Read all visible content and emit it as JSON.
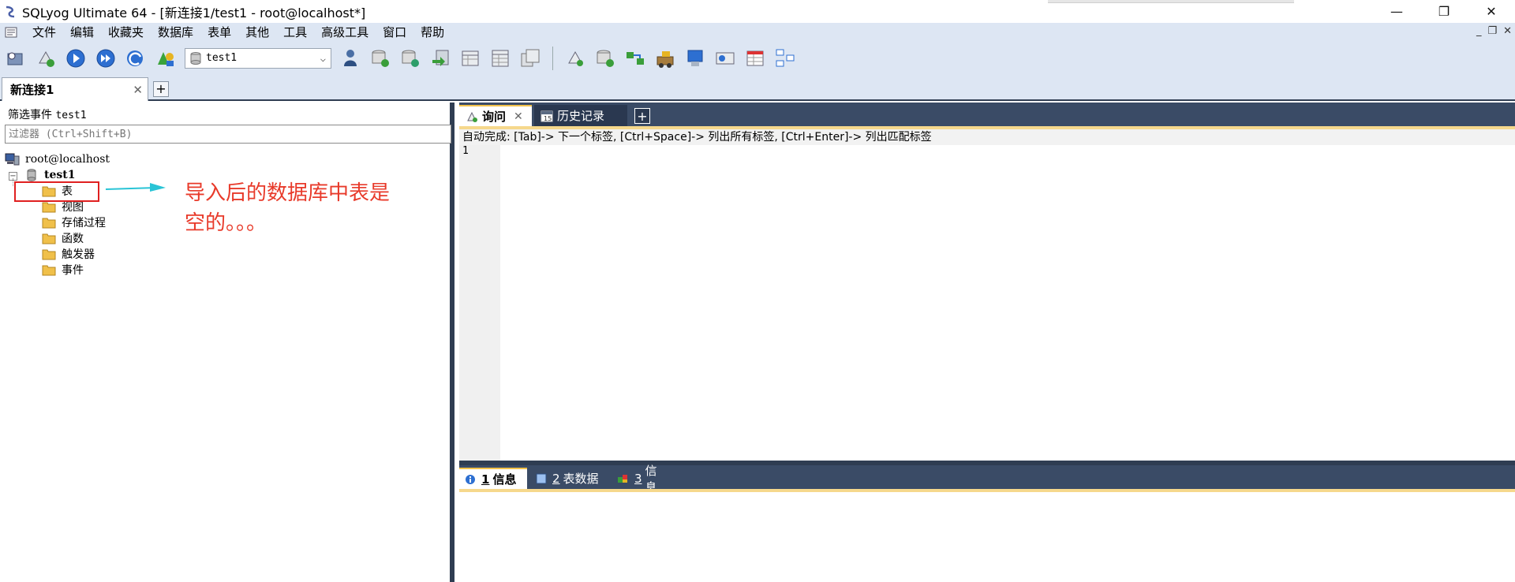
{
  "window": {
    "title": "SQLyog Ultimate 64 - [新连接1/test1 - root@localhost*]",
    "minimize": "—",
    "maximize": "❐",
    "close": "✕"
  },
  "menu": {
    "items": [
      "文件",
      "编辑",
      "收藏夹",
      "数据库",
      "表单",
      "其他",
      "工具",
      "高级工具",
      "窗口",
      "帮助"
    ],
    "mdi": {
      "minimize": "_",
      "restore": "❐",
      "close": "✕"
    }
  },
  "toolbar": {
    "database_select": "test1",
    "icons": [
      "new-connection-icon",
      "connect-icon",
      "execute-icon",
      "execute-all-icon",
      "refresh-icon",
      "schema-icon",
      "user-manager-icon",
      "backup-db-icon",
      "restore-db-icon",
      "import-icon",
      "table-icon",
      "table-data-icon",
      "query-builder-icon",
      "schema-designer-icon",
      "sync-icon",
      "data-transfer-icon",
      "job-agent-icon",
      "notification-icon",
      "query-profiler-icon",
      "grid-icon",
      "layout-icon"
    ]
  },
  "connection_tabs": [
    {
      "label": "新连接1"
    }
  ],
  "left_pane": {
    "filter_label": "筛选事件",
    "filter_db": "test1",
    "filter_placeholder": "过滤器 (Ctrl+Shift+B)",
    "tree": {
      "server": "root@localhost",
      "database": "test1",
      "folders": [
        "表",
        "视图",
        "存储过程",
        "函数",
        "触发器",
        "事件"
      ]
    },
    "annotation": "导入后的数据库中表是空的。。。"
  },
  "right_pane": {
    "tabs": [
      {
        "label": "询问"
      },
      {
        "label": "历史记录"
      }
    ],
    "hint": "自动完成: [Tab]-> 下一个标签, [Ctrl+Space]-> 列出所有标签, [Ctrl+Enter]-> 列出匹配标签",
    "line_number": "1",
    "bottom_tabs": [
      {
        "num": "1",
        "label": "信息"
      },
      {
        "num": "2",
        "label": "表数据"
      },
      {
        "num": "3",
        "label": "信息"
      }
    ]
  },
  "colors": {
    "chrome_bg": "#dde6f3",
    "dark_panel": "#3a4b66",
    "accent_gold": "#f6d88c",
    "annotation_red": "#e83a2a",
    "annotation_arrow": "#29c4d6"
  }
}
